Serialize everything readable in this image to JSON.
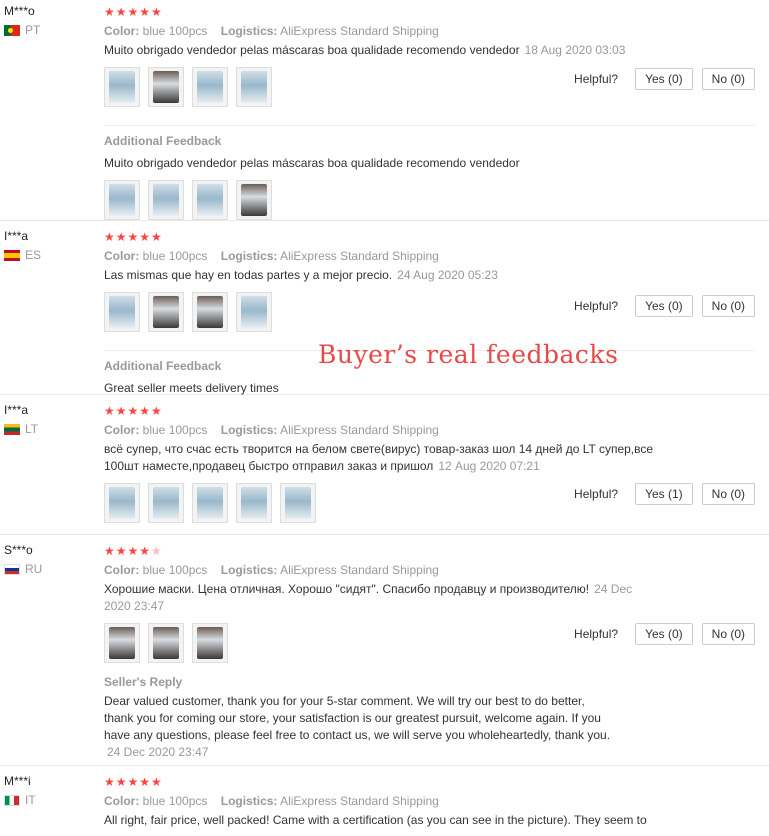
{
  "colors": {
    "star": "#ff4747",
    "muted": "#999999",
    "watermark": "#e84848"
  },
  "helpful_label": "Helpful?",
  "attr_labels": {
    "color": "Color:",
    "logistics": "Logistics:"
  },
  "watermark": "Buyer’s real feedbacks",
  "reviews": [
    {
      "user": "M***o",
      "country": "PT",
      "flag": "portugal-flag-icon",
      "rating": 5,
      "stars": "★★★★★",
      "color": "blue 100pcs",
      "logistics": "AliExpress Standard Shipping",
      "text": "Muito obrigado vendedor pelas máscaras boa qualidade recomendo vendedor",
      "date": "18 Aug 2020 03:03",
      "yes": "Yes (0)",
      "no": "No (0)",
      "additional_title": "Additional Feedback",
      "additional_text": "Muito obrigado vendedor pelas máscaras boa qualidade recomendo vendedor"
    },
    {
      "user": "I***a",
      "country": "ES",
      "flag": "spain-flag-icon",
      "rating": 5,
      "stars": "★★★★★",
      "color": "blue 100pcs",
      "logistics": "AliExpress Standard Shipping",
      "text": "Las mismas que hay en todas partes y a mejor precio.",
      "date": "24 Aug 2020 05:23",
      "yes": "Yes (0)",
      "no": "No (0)",
      "additional_title": "Additional Feedback",
      "additional_text": "Great seller meets delivery times"
    },
    {
      "user": "I***a",
      "country": "LT",
      "flag": "lithuania-flag-icon",
      "rating": 5,
      "stars": "★★★★★",
      "color": "blue 100pcs",
      "logistics": "AliExpress Standard Shipping",
      "text_line1": "всё супер, что счас есть творится на белом свете(вирус) товар-заказ шол 14 дней до LT супер,все",
      "text_line2": "100шт наместе,продавец быстро отправил заказ и пришол",
      "date": "12 Aug 2020 07:21",
      "yes": "Yes (1)",
      "no": "No (0)"
    },
    {
      "user": "S***o",
      "country": "RU",
      "flag": "russia-flag-icon",
      "rating": 4.5,
      "stars": "★★★★",
      "color": "blue 100pcs",
      "logistics": "AliExpress Standard Shipping",
      "text": "Хорошие маски. Цена отличная. Хорошо \"сидят\". Спасибо продавцу и производителю!",
      "date_part1": "24 Dec",
      "date_part2": "2020 23:47",
      "yes": "Yes (0)",
      "no": "No (0)",
      "reply_title": "Seller's Reply",
      "reply_line1": "Dear valued customer, thank you for your 5-star comment. We will try our best to do better,",
      "reply_line2": "thank you for coming our store, your satisfaction is our greatest pursuit, welcome again. If you",
      "reply_line3": "have any questions, please feel free to contact us, we will serve you wholeheartedly, thank you.",
      "reply_date": "24 Dec 2020 23:47"
    },
    {
      "user": "M***i",
      "country": "IT",
      "flag": "italy-flag-icon",
      "rating": 5,
      "stars": "★★★★★",
      "color": "blue 100pcs",
      "logistics": "AliExpress Standard Shipping",
      "text": "All right, fair price, well packed! Came with a certification (as you can see in the picture). They seem to"
    }
  ]
}
